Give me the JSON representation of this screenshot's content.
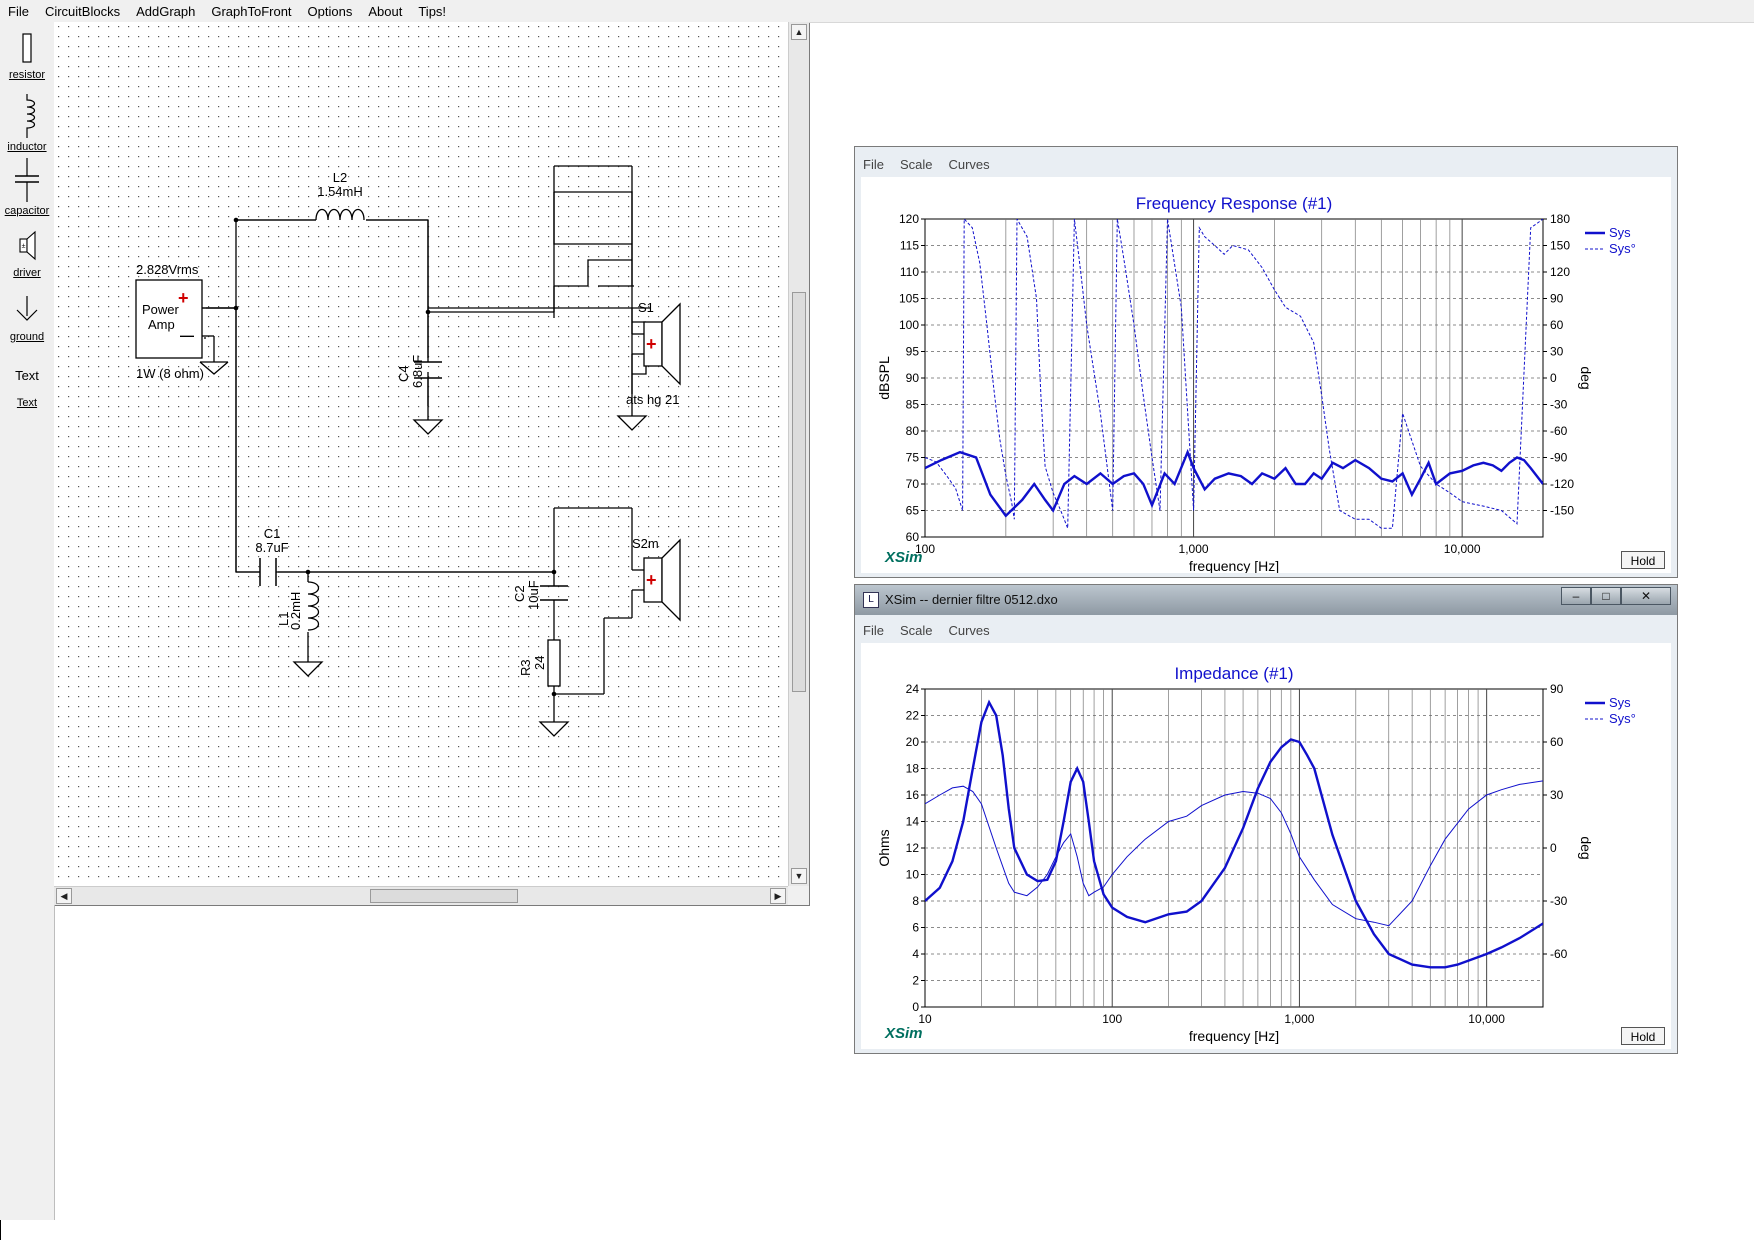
{
  "circuit_window": {
    "menu": [
      "File",
      "CircuitBlocks",
      "AddGraph",
      "GraphToFront",
      "Options",
      "About",
      "Tips!"
    ],
    "palette": [
      {
        "label": "resistor",
        "icon": "resistor-icon"
      },
      {
        "label": "inductor",
        "icon": "inductor-icon"
      },
      {
        "label": "capacitor",
        "icon": "capacitor-icon"
      },
      {
        "label": "driver",
        "icon": "speaker-icon"
      },
      {
        "label": "ground",
        "icon": "ground-icon"
      },
      {
        "label": "Text",
        "icon": "text-icon",
        "preview": "Text"
      }
    ],
    "schematic": {
      "source_voltage": "2.828Vrms",
      "source_name_1": "Power",
      "source_name_2": "Amp",
      "source_power": "1W (8 ohm)",
      "L2_name": "L2",
      "L2_value": "1.54mH",
      "C4_name": "C4",
      "C4_value": "6.8uF",
      "S1_name": "S1",
      "S1_model": "ats hg 21",
      "C1_name": "C1",
      "C1_value": "8.7uF",
      "L1_name": "L1",
      "L1_value": "0.2mH",
      "C2_name": "C2",
      "C2_value": "10uF",
      "R3_name": "R3",
      "R3_value": "24",
      "S2_name": "S2m",
      "plus_sign": "+",
      "minus_sign": "—"
    }
  },
  "graph_windows": [
    {
      "menu": [
        "File",
        "Scale",
        "Curves"
      ],
      "brand": "XSim",
      "hold_label": "Hold",
      "legend": [
        "Sys",
        "Sys°"
      ]
    },
    {
      "window_title": "XSim -- dernier filtre 0512.dxo",
      "title_icon": "xsim-app-icon",
      "window_buttons": [
        "–",
        "□",
        "✕"
      ],
      "menu": [
        "File",
        "Scale",
        "Curves"
      ],
      "brand": "XSim",
      "hold_label": "Hold",
      "legend": [
        "Sys",
        "Sys°"
      ]
    }
  ],
  "chart_data": [
    {
      "type": "line",
      "title": "Frequency Response (#1)",
      "xlabel": "frequency [Hz]",
      "ylabel": "dBSPL",
      "y2label": "deg",
      "xscale": "log",
      "xlim": [
        100,
        20000
      ],
      "ylim": [
        60,
        120
      ],
      "y2lim": [
        -180,
        180
      ],
      "x_ticks": [
        "100",
        "1,000",
        "10,000"
      ],
      "y_ticks": [
        "60",
        "65",
        "70",
        "75",
        "80",
        "85",
        "90",
        "95",
        "100",
        "105",
        "110",
        "115",
        "120"
      ],
      "y2_ticks": [
        "-150",
        "-120",
        "-90",
        "-60",
        "-30",
        "0",
        "30",
        "60",
        "90",
        "120",
        "150",
        "180"
      ],
      "grid": true,
      "legend_position": "top-right",
      "colors": {
        "sys": "#1010cc"
      },
      "series": [
        {
          "name": "Sys",
          "style": "solid",
          "x": [
            100,
            115,
            135,
            155,
            175,
            200,
            230,
            255,
            280,
            300,
            330,
            360,
            400,
            450,
            500,
            550,
            600,
            650,
            700,
            780,
            850,
            950,
            1000,
            1100,
            1200,
            1350,
            1500,
            1650,
            1800,
            2000,
            2200,
            2400,
            2600,
            2800,
            3000,
            3300,
            3600,
            4000,
            4500,
            5000,
            5500,
            6000,
            6500,
            7000,
            7500,
            8000,
            9000,
            10000,
            11000,
            12000,
            13000,
            14000,
            15000,
            16000,
            17000,
            18000,
            20000
          ],
          "y": [
            73,
            74.5,
            76,
            75,
            68,
            64,
            67,
            70,
            67,
            65,
            70,
            71.5,
            70,
            72,
            70,
            71.5,
            72,
            70,
            66,
            72,
            70,
            76,
            73,
            69,
            71,
            72,
            71.5,
            70,
            72,
            71,
            73,
            70,
            70,
            72,
            71,
            74,
            73,
            74.5,
            73,
            71,
            70.5,
            72,
            68,
            71,
            74,
            70,
            72,
            72.5,
            73.5,
            74,
            73.5,
            72.5,
            74,
            75,
            74.5,
            73,
            70
          ]
        },
        {
          "name": "Sys°",
          "style": "dashed",
          "x": [
            100,
            110,
            120,
            130,
            138,
            140,
            150,
            160,
            170,
            180,
            190,
            200,
            210,
            215,
            220,
            240,
            260,
            270,
            280,
            300,
            320,
            340,
            360,
            380,
            400,
            450,
            500,
            520,
            540,
            560,
            600,
            650,
            700,
            750,
            800,
            900,
            1000,
            1050,
            1100,
            1200,
            1300,
            1400,
            1600,
            1800,
            2000,
            2200,
            2500,
            2800,
            3000,
            3200,
            3500,
            4000,
            4500,
            5000,
            5500,
            6000,
            7000,
            8000,
            9000,
            10000,
            12000,
            14000,
            16000,
            18000,
            19000,
            20000
          ],
          "y": [
            -90,
            -95,
            -110,
            -125,
            -150,
            180,
            170,
            130,
            60,
            -10,
            -70,
            -110,
            -140,
            -160,
            180,
            160,
            90,
            -20,
            -100,
            -130,
            -150,
            -170,
            180,
            120,
            60,
            -40,
            -150,
            180,
            150,
            120,
            60,
            -20,
            -90,
            -150,
            180,
            80,
            -150,
            170,
            160,
            150,
            140,
            150,
            145,
            125,
            100,
            80,
            70,
            40,
            -20,
            -80,
            -150,
            -160,
            -160,
            -170,
            -170,
            -40,
            -100,
            -120,
            -130,
            -140,
            -145,
            -150,
            -165,
            170,
            175,
            180
          ]
        }
      ]
    },
    {
      "type": "line",
      "title": "Impedance (#1)",
      "xlabel": "frequency [Hz]",
      "ylabel": "Ohms",
      "y2label": "deg",
      "xscale": "log",
      "xlim": [
        10,
        20000
      ],
      "ylim": [
        0,
        24
      ],
      "y2lim": [
        -90,
        90
      ],
      "x_ticks": [
        "10",
        "100",
        "1,000",
        "10,000"
      ],
      "y_ticks": [
        "0",
        "2",
        "4",
        "6",
        "8",
        "10",
        "12",
        "14",
        "16",
        "18",
        "20",
        "22",
        "24"
      ],
      "y2_ticks": [
        "-60",
        "-30",
        "0",
        "30",
        "60",
        "90"
      ],
      "grid": true,
      "legend_position": "top-right",
      "colors": {
        "sys": "#1010cc"
      },
      "series": [
        {
          "name": "Sys",
          "style": "solid",
          "x": [
            10,
            12,
            14,
            16,
            18,
            20,
            22,
            24,
            26,
            28,
            30,
            35,
            40,
            45,
            50,
            55,
            60,
            65,
            70,
            75,
            80,
            90,
            100,
            120,
            150,
            200,
            250,
            300,
            400,
            500,
            600,
            700,
            800,
            900,
            1000,
            1100,
            1200,
            1500,
            2000,
            2500,
            3000,
            4000,
            5000,
            6000,
            7000,
            8000,
            10000,
            12000,
            15000,
            20000
          ],
          "y": [
            8,
            9,
            11,
            14,
            18,
            21.5,
            23,
            22,
            19,
            15,
            12,
            10,
            9.5,
            9.6,
            11,
            14,
            17,
            18,
            17,
            14,
            11,
            8.5,
            7.5,
            6.8,
            6.4,
            7,
            7.2,
            8,
            10.5,
            13.5,
            16.5,
            18.5,
            19.6,
            20.2,
            20,
            19,
            18,
            13,
            8,
            5.5,
            4,
            3.2,
            3,
            3,
            3.2,
            3.5,
            4,
            4.5,
            5.2,
            6.3
          ]
        },
        {
          "name": "Sys°",
          "style": "solid",
          "x": [
            10,
            12,
            14,
            16,
            18,
            20,
            24,
            28,
            30,
            35,
            40,
            45,
            50,
            55,
            60,
            65,
            70,
            75,
            80,
            90,
            100,
            120,
            150,
            200,
            250,
            300,
            400,
            500,
            600,
            700,
            800,
            900,
            1000,
            1200,
            1500,
            2000,
            2500,
            3000,
            4000,
            5000,
            6000,
            8000,
            10000,
            12000,
            15000,
            20000
          ],
          "y": [
            25,
            30,
            34,
            35,
            32,
            25,
            0,
            -20,
            -25,
            -27,
            -22,
            -15,
            -5,
            3,
            8,
            -5,
            -20,
            -27,
            -25,
            -22,
            -15,
            -5,
            5,
            15,
            18,
            24,
            30,
            32,
            31,
            28,
            20,
            8,
            -5,
            -18,
            -32,
            -40,
            -42,
            -44,
            -30,
            -10,
            5,
            22,
            30,
            33,
            36,
            38
          ]
        }
      ]
    }
  ]
}
